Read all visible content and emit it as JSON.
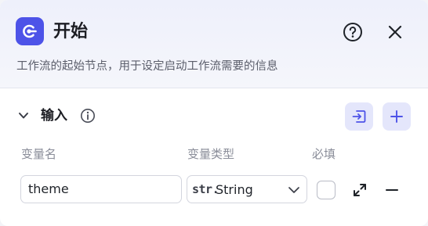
{
  "header": {
    "title": "开始",
    "description": "工作流的起始节点，用于设定启动工作流需要的信息",
    "icons": {
      "app": "start-node-icon",
      "help": "question-circle-icon",
      "close": "close-icon"
    },
    "accent_color": "#4d53e8"
  },
  "inputs_section": {
    "title": "输入",
    "icons": {
      "collapse": "chevron-down-icon",
      "info": "info-circle-icon",
      "import": "import-icon",
      "add": "plus-icon"
    },
    "columns": {
      "name": "变量名",
      "type": "变量类型",
      "required": "必填"
    },
    "rows": [
      {
        "name": "theme",
        "type_prefix": "str.",
        "type": "String",
        "required": false
      }
    ]
  }
}
